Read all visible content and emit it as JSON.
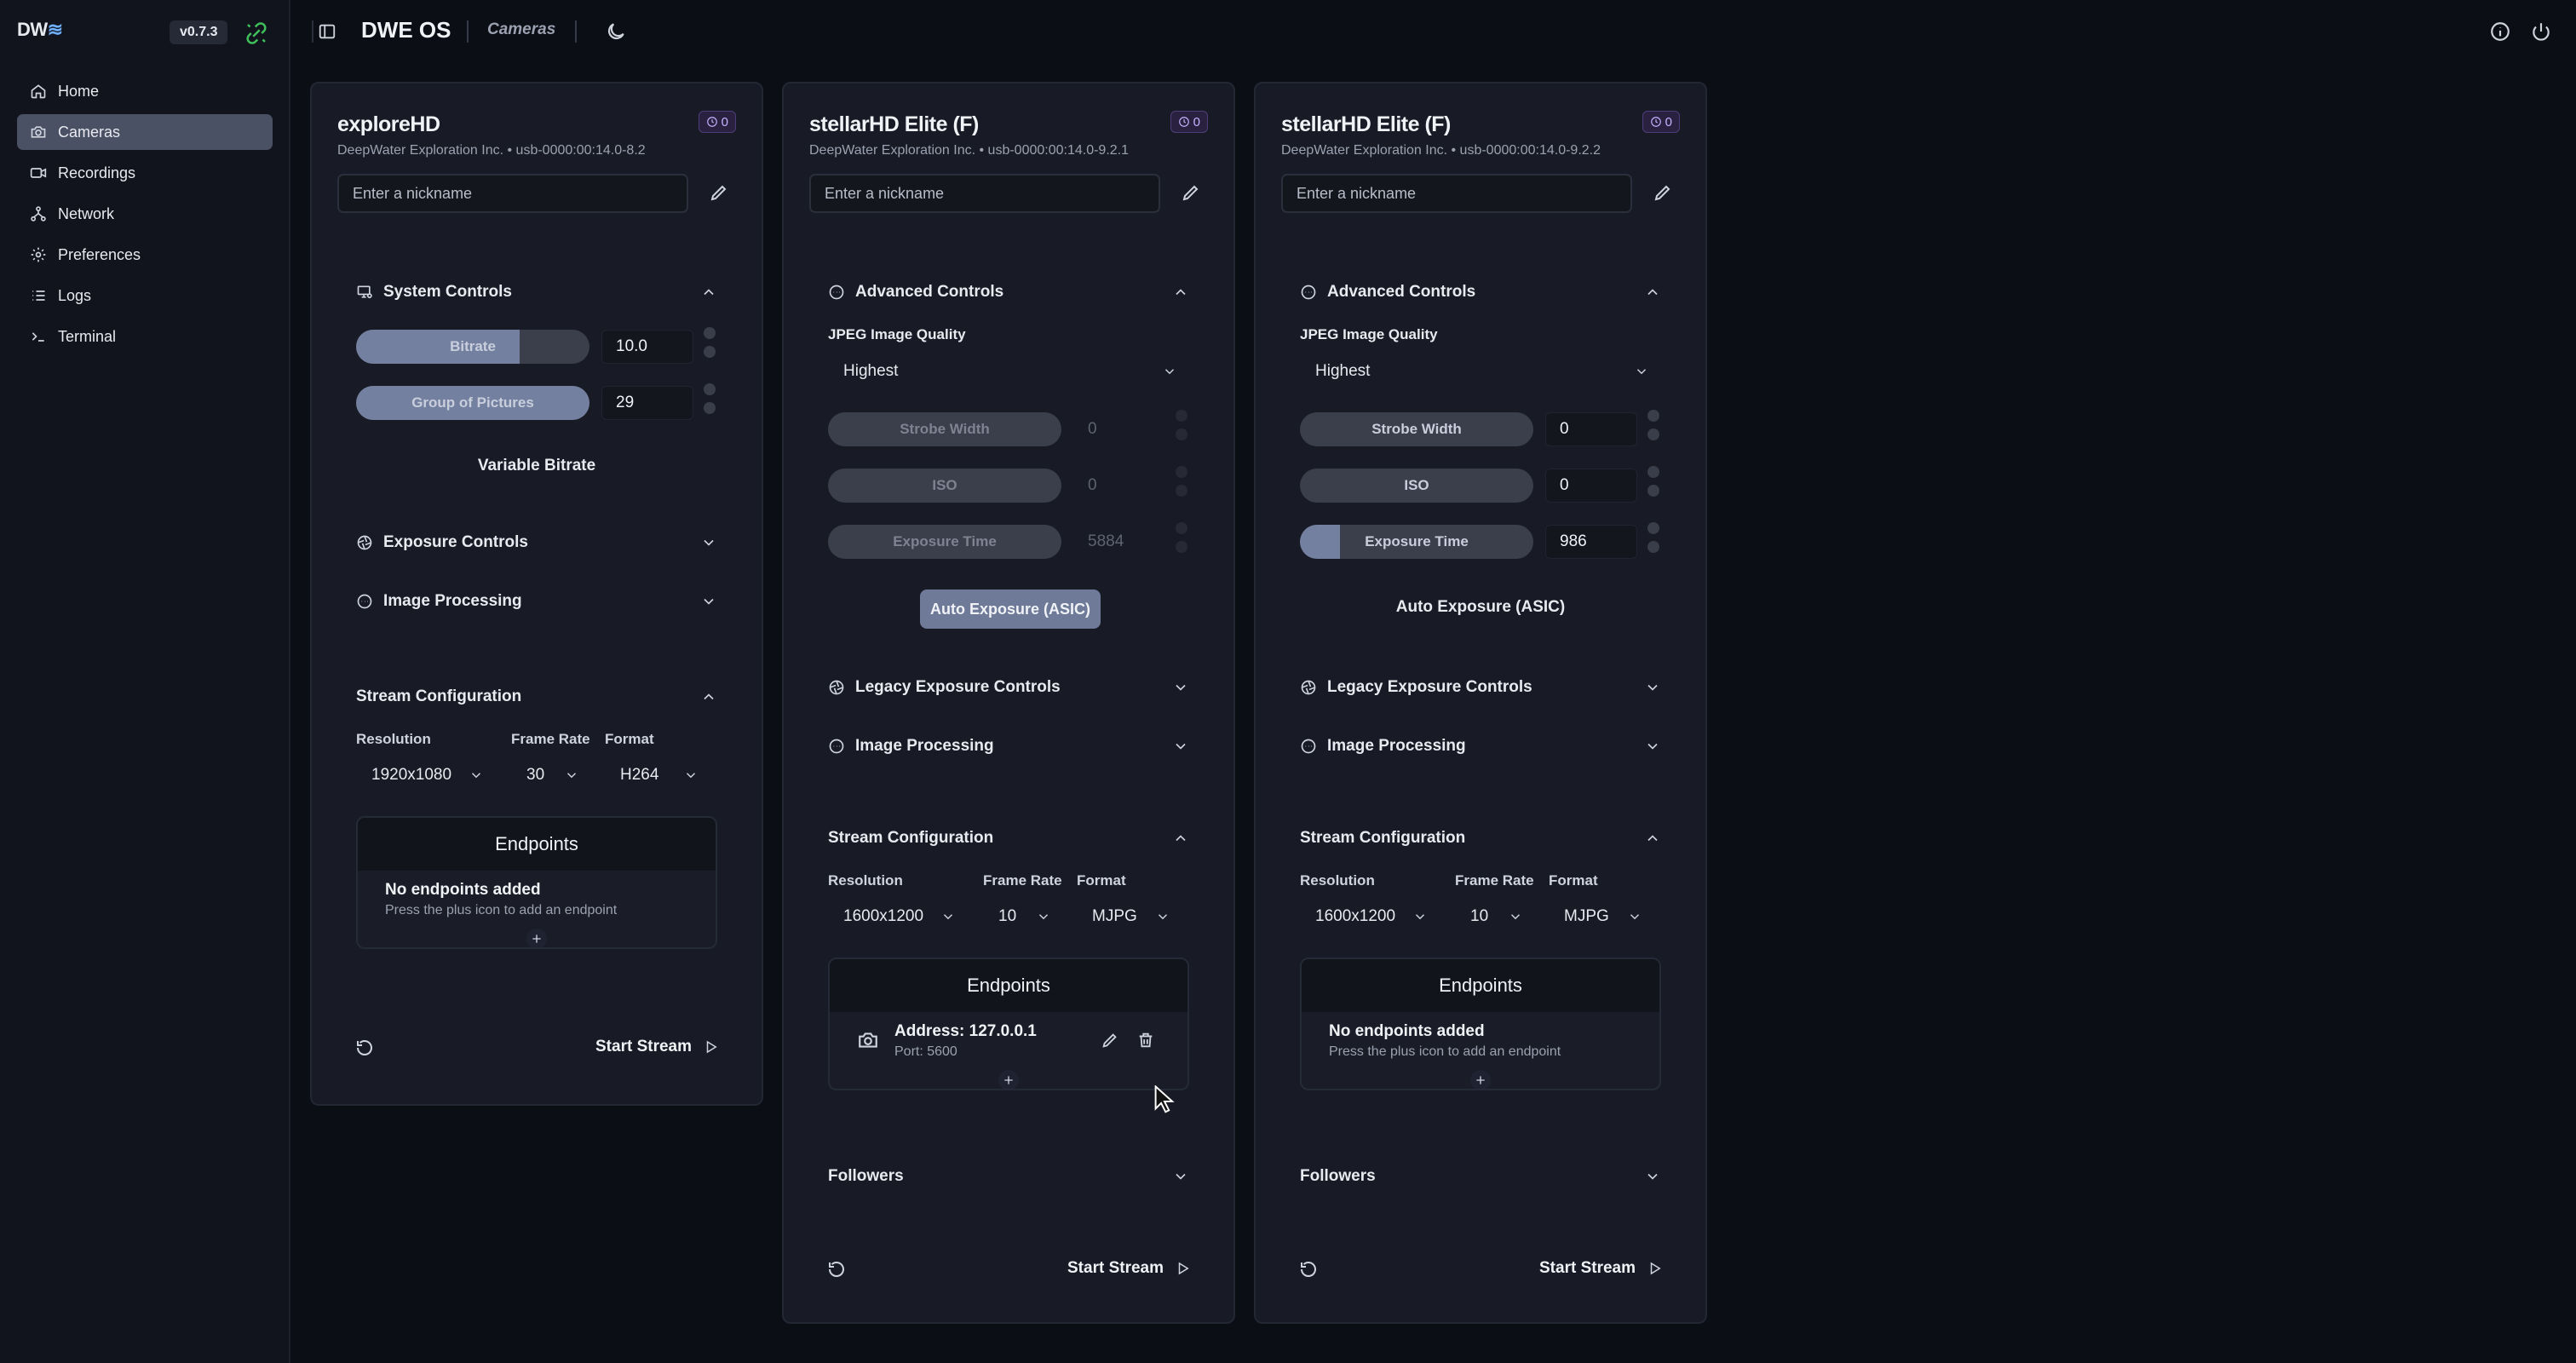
{
  "app": {
    "logo": "DW",
    "version": "v0.7.3",
    "title": "DWE OS",
    "page": "Cameras"
  },
  "sidebar": {
    "items": [
      {
        "label": "Home",
        "icon": "home-icon",
        "active": false
      },
      {
        "label": "Cameras",
        "icon": "camera-icon",
        "active": true
      },
      {
        "label": "Recordings",
        "icon": "video-icon",
        "active": false
      },
      {
        "label": "Network",
        "icon": "network-icon",
        "active": false
      },
      {
        "label": "Preferences",
        "icon": "gear-icon",
        "active": false
      },
      {
        "label": "Logs",
        "icon": "list-icon",
        "active": false
      },
      {
        "label": "Terminal",
        "icon": "terminal-icon",
        "active": false
      }
    ]
  },
  "cards": [
    {
      "title": "exploreHD",
      "subtitle": "DeepWater Exploration Inc. • usb-0000:00:14.0-8.2",
      "badge": "0",
      "nickname_placeholder": "Enter a nickname",
      "system_controls": {
        "label": "System Controls",
        "bitrate_label": "Bitrate",
        "bitrate_value": "10.0",
        "bitrate_fraction": 0.7,
        "gop_label": "Group of Pictures",
        "gop_value": "29",
        "gop_fraction": 1.0,
        "mode_label": "Variable Bitrate"
      },
      "exposure_label": "Exposure Controls",
      "image_processing_label": "Image Processing",
      "stream": {
        "label": "Stream Configuration",
        "resolution_label": "Resolution",
        "resolution": "1920x1080",
        "framerate_label": "Frame Rate",
        "framerate": "30",
        "format_label": "Format",
        "format": "H264"
      },
      "endpoints": {
        "label": "Endpoints",
        "empty_title": "No endpoints added",
        "empty_sub": "Press the plus icon to add an endpoint"
      },
      "start_label": "Start Stream"
    },
    {
      "title": "stellarHD Elite (F)",
      "subtitle": "DeepWater Exploration Inc. • usb-0000:00:14.0-9.2.1",
      "badge": "0",
      "nickname_placeholder": "Enter a nickname",
      "advanced": {
        "label": "Advanced Controls",
        "jpeg_label": "JPEG Image Quality",
        "jpeg_value": "Highest",
        "strobe_label": "Strobe Width",
        "strobe_value": "0",
        "iso_label": "ISO",
        "iso_value": "0",
        "exposure_label": "Exposure Time",
        "exposure_value": "5884",
        "auto_label": "Auto Exposure (ASIC)"
      },
      "legacy_label": "Legacy Exposure Controls",
      "image_processing_label": "Image Processing",
      "stream": {
        "label": "Stream Configuration",
        "resolution_label": "Resolution",
        "resolution": "1600x1200",
        "framerate_label": "Frame Rate",
        "framerate": "10",
        "format_label": "Format",
        "format": "MJPG"
      },
      "endpoints": {
        "label": "Endpoints",
        "address": "Address: 127.0.0.1",
        "port": "Port: 5600"
      },
      "followers_label": "Followers",
      "start_label": "Start Stream"
    },
    {
      "title": "stellarHD Elite (F)",
      "subtitle": "DeepWater Exploration Inc. • usb-0000:00:14.0-9.2.2",
      "badge": "0",
      "nickname_placeholder": "Enter a nickname",
      "advanced": {
        "label": "Advanced Controls",
        "jpeg_label": "JPEG Image Quality",
        "jpeg_value": "Highest",
        "strobe_label": "Strobe Width",
        "strobe_value": "0",
        "iso_label": "ISO",
        "iso_value": "0",
        "exposure_label": "Exposure Time",
        "exposure_value": "986",
        "exposure_fraction": 0.17,
        "auto_label": "Auto Exposure (ASIC)"
      },
      "legacy_label": "Legacy Exposure Controls",
      "image_processing_label": "Image Processing",
      "stream": {
        "label": "Stream Configuration",
        "resolution_label": "Resolution",
        "resolution": "1600x1200",
        "framerate_label": "Frame Rate",
        "framerate": "10",
        "format_label": "Format",
        "format": "MJPG"
      },
      "endpoints": {
        "label": "Endpoints",
        "empty_title": "No endpoints added",
        "empty_sub": "Press the plus icon to add an endpoint"
      },
      "followers_label": "Followers",
      "start_label": "Start Stream"
    }
  ],
  "colors": {
    "accent": "#6e7a98",
    "badge": "#c4b2ff",
    "connected": "#3fbf5a"
  }
}
